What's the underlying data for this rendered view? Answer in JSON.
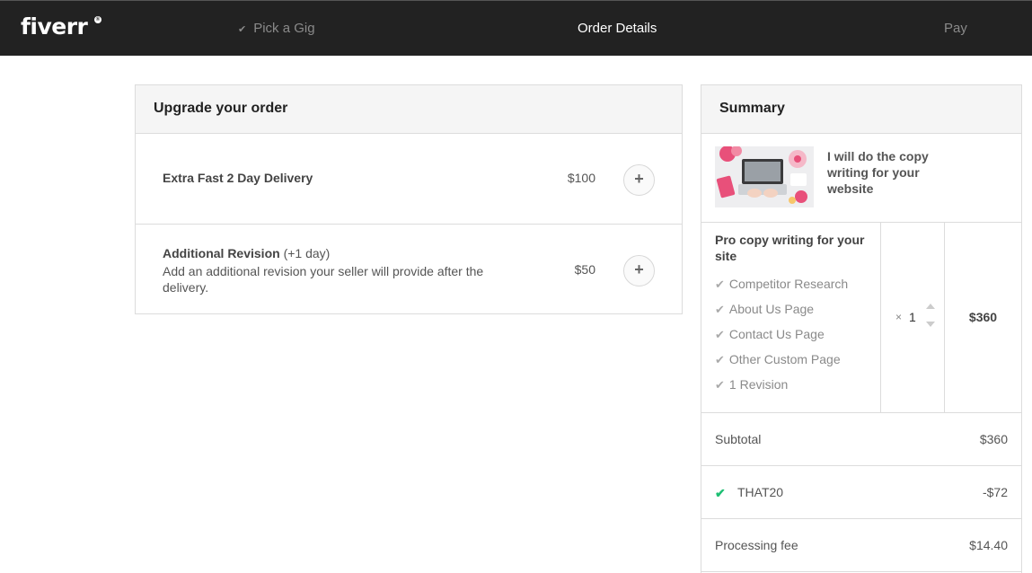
{
  "brand": {
    "logo_text": "fiverr",
    "logo_mark": "®"
  },
  "steps": [
    {
      "label": "Pick a Gig",
      "done": true
    },
    {
      "label": "Order Details",
      "active": true
    },
    {
      "label": "Pay"
    }
  ],
  "upgrade": {
    "heading": "Upgrade your order",
    "items": [
      {
        "title": "Extra Fast 2 Day Delivery",
        "extra": "",
        "description": "",
        "price": "$100",
        "button": "+"
      },
      {
        "title": "Additional Revision",
        "extra": "(+1 day)",
        "description": "Add an additional revision your seller will provide after the delivery.",
        "price": "$50",
        "button": "+"
      }
    ]
  },
  "summary": {
    "heading": "Summary",
    "gig_title": "I will do the copy writing for your website",
    "package": {
      "title": "Pro copy writing for your site",
      "features": [
        "Competitor Research",
        "About Us Page",
        "Contact Us Page",
        "Other Custom Page",
        "1 Revision"
      ],
      "qty_prefix": "×",
      "quantity": "1",
      "price": "$360"
    },
    "subtotal": {
      "label": "Subtotal",
      "value": "$360"
    },
    "coupon": {
      "label": "THAT20",
      "value": "-$72"
    },
    "processing_fee": {
      "label": "Processing fee",
      "value": "$14.40"
    }
  },
  "colors": {
    "topbar": "#222222",
    "accent_green": "#1dbf73",
    "border": "#dcdcdc"
  }
}
